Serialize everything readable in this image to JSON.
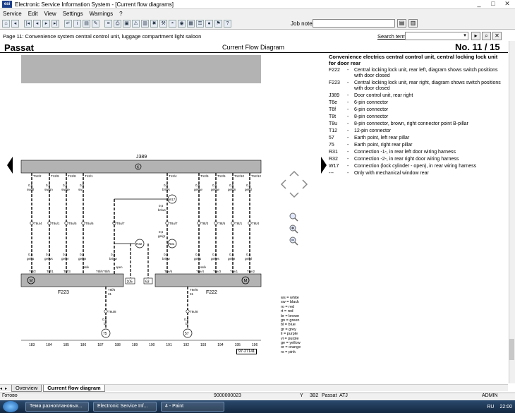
{
  "window": {
    "title": "Electronic Service Information System - [Current flow diagrams]",
    "logo_text": "esi",
    "controls": [
      "_",
      "□",
      "✕"
    ]
  },
  "menu": [
    "Service",
    "Edit",
    "View",
    "Settings",
    "Warnings",
    "?"
  ],
  "toolbar": {
    "job_note_label": "Job note:",
    "job_note_value": ""
  },
  "page_line": "Page 11: Convenience system central control unit, luggage compartment light saloon",
  "search": {
    "label": "Search term:",
    "value": ""
  },
  "doc": {
    "model": "Passat",
    "title": "Current Flow Diagram",
    "page_number": "No.  11 / 15"
  },
  "legend": {
    "heading": "Convenience electrics central control unit, central locking lock unit for door rear",
    "rows": [
      {
        "code": "F222",
        "desc": "Central locking lock unit, rear left, diagram shows switch positions with door closed"
      },
      {
        "code": "F223",
        "desc": "Central locking lock unit, rear right, diagram shows switch positions with door closed"
      },
      {
        "code": "J389",
        "desc": "Door control unit, rear right"
      },
      {
        "code": "T6e",
        "desc": "6-pin connector"
      },
      {
        "code": "T6f",
        "desc": "6-pin connector"
      },
      {
        "code": "T8t",
        "desc": "8-pin connector"
      },
      {
        "code": "T8u",
        "desc": "8-pin connector, brown, right connector point B-pillar"
      },
      {
        "code": "T12",
        "desc": "12-pin connector"
      },
      {
        "code": "57",
        "desc": "Earth point, left rear pillar"
      },
      {
        "code": "75",
        "desc": "Earth point, right rear pillar"
      },
      {
        "code": "R31",
        "desc": "Connection -1-, in rear left door wiring harness"
      },
      {
        "code": "R32",
        "desc": "Connection -2-, in rear right door wiring harness"
      },
      {
        "code": "W17",
        "desc": "Connection (lock cylinder - open), in rear wiring harness"
      },
      {
        "code": "---",
        "desc": "Only with mechanical window rear"
      }
    ]
  },
  "color_codes": [
    "ws = white",
    "sw = black",
    "ro = red",
    "rt = red",
    "br = brown",
    "gn = green",
    "bl = blue",
    "gr = grey",
    "li = purple",
    "vi = purple",
    "ge = yellow",
    "or = orange",
    "rs = pink"
  ],
  "diagram": {
    "unit_label": "J389",
    "unit_symbol": "K",
    "top_pins": [
      "T12/2",
      "T12/9",
      "T12/8",
      "T12/1",
      "T12/4",
      "T12/5",
      "T12/5",
      "T12/10",
      "T12/12"
    ],
    "top_gauges": [
      "0,5",
      "0,5",
      "0,5",
      "0,5",
      "0,5",
      "0,5",
      "0,5",
      "0,5",
      "0,5"
    ],
    "top_colors": [
      "sw/bl",
      "sw/gn",
      "sw/ge",
      "sw",
      "br/ws",
      "ge/sw",
      "ge/sw",
      "ge/gn",
      "ge/bl"
    ],
    "mid_connectors": [
      "T8u/4",
      "T8u/1",
      "T8u/5",
      "T8u/6",
      "T8u/7",
      "T8u/7",
      "T8t/3",
      "T8t/5",
      "T8t/1",
      "T8t/4"
    ],
    "lower_gauges": [
      "0,5",
      "0,5",
      "0,5",
      "0,5",
      "0,5",
      "0,5",
      "0,5",
      "0,5",
      "0,5",
      "0,5"
    ],
    "lower_colors": [
      "ge/ro",
      "ge/ws",
      "ge/br",
      "ge/gn",
      "br/sw",
      "br/sw",
      "ge/ro",
      "ge/ws",
      "ge/br",
      "ge/bl"
    ],
    "junction_w17": "W17",
    "junction_r32": "R32",
    "junction_r31": "R31",
    "w17_gauge": "0,5",
    "w17_color": "br/ws",
    "r31_gauge": "0,5",
    "r31_color": "ge/gr",
    "left_unit": "F223",
    "right_unit": "F222",
    "left_pins": [
      "T6f/2",
      "T6f/1",
      "T6f/3",
      "T6f/6",
      "T6f/5"
    ],
    "right_pins": [
      "T6e/6",
      "T6e/4",
      "T6e/3",
      "T6e/1",
      "T6e/2"
    ],
    "safe_label": "safe",
    "open_label": "open",
    "ref_105": "105",
    "ref_63": "63",
    "bottom_left_pin": "T6f/5",
    "bottom_right_pin": "T6e/5",
    "bottom_left_conn": "T8u/8",
    "bottom_right_conn": "T8u/8",
    "bottom_num": "31",
    "bottom_gauge": "0,5",
    "bottom_color": "br",
    "earth_left": "75",
    "earth_right": "57",
    "track_numbers": [
      "183",
      "184",
      "185",
      "186",
      "187",
      "188",
      "189",
      "190",
      "191",
      "192",
      "193",
      "194",
      "195",
      "196"
    ],
    "sheet_no": "97-27141"
  },
  "tabs": [
    "Overview",
    "Current flow diagram"
  ],
  "status": {
    "left": "Готово",
    "doc_id": "9000000023",
    "y": "Y",
    "code": "3B2",
    "model": "Passat",
    "variant": "ATJ",
    "user": "ADMIN"
  },
  "taskbar": {
    "items": [
      "Тема разноплановых...",
      "Electronic Service Inf...",
      "4 - Paint"
    ],
    "lang": "RU",
    "time": "22:00"
  }
}
